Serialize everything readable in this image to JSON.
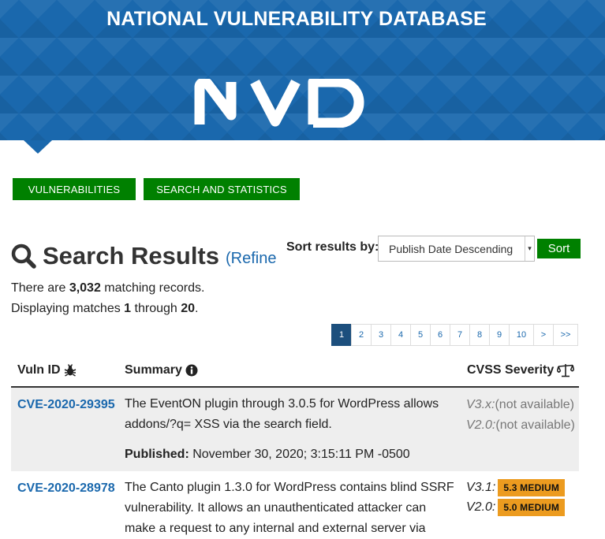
{
  "header": {
    "title": "NATIONAL VULNERABILITY DATABASE",
    "logo_text": "NVD",
    "banner_color": "#1a68ad"
  },
  "nav": {
    "vulnerabilities": "VULNERABILITIES",
    "search_stats": "SEARCH AND STATISTICS",
    "button_color": "#008000"
  },
  "results": {
    "heading": "Search Results",
    "refine": "(Refine",
    "count_prefix": "There are ",
    "count": "3,032",
    "count_suffix": " matching records.",
    "display_prefix": "Displaying matches ",
    "from": "1",
    "through_word": " through ",
    "to": "20",
    "display_suffix": "."
  },
  "sort": {
    "label": "Sort results by:",
    "selected": "Publish Date Descending",
    "button": "Sort"
  },
  "pagination": {
    "pages": [
      "1",
      "2",
      "3",
      "4",
      "5",
      "6",
      "7",
      "8",
      "9",
      "10",
      ">",
      ">>"
    ],
    "current": "1"
  },
  "table": {
    "headers": {
      "vuln_id": "Vuln ID",
      "summary": "Summary",
      "cvss": "CVSS Severity"
    },
    "rows": [
      {
        "id": "CVE-2020-29395",
        "summary_line1": "The EventON plugin through 3.0.5 for WordPress allows",
        "summary_line2": "addons/?q= XSS via the search field.",
        "published_label": "Published:",
        "published": " November 30, 2020; 3:15:11 PM -0500",
        "v3_label": "V3.x:",
        "v3_value": "(not available)",
        "v2_label": "V2.0:",
        "v2_value": "(not available)"
      },
      {
        "id": "CVE-2020-28978",
        "summary_line1": "The Canto plugin 1.3.0 for WordPress contains blind SSRF",
        "summary_line2": "vulnerability. It allows an unauthenticated attacker can",
        "summary_line3": "make a request to any internal and external server via",
        "v3_label": "V3.1:",
        "v3_badge": "5.3 MEDIUM",
        "v2_label": "V2.0:",
        "v2_badge": "5.0 MEDIUM",
        "badge_color": "#ec9b1f"
      }
    ]
  }
}
